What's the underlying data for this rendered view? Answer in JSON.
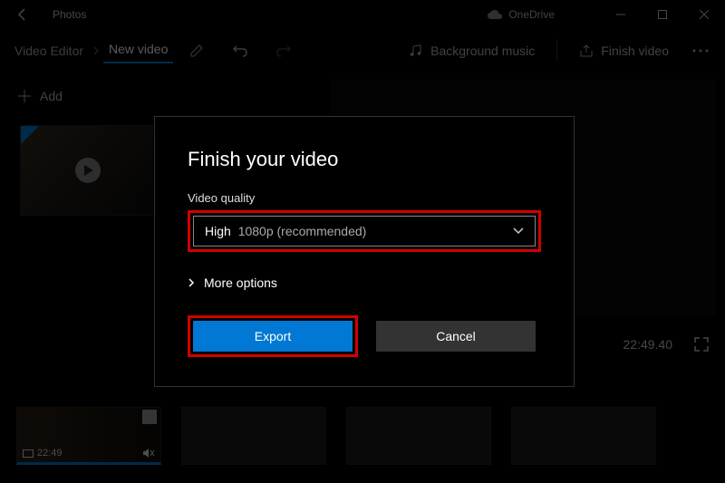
{
  "titlebar": {
    "app_name": "Photos",
    "onedrive_label": "OneDrive"
  },
  "toolbar": {
    "breadcrumb": "Video Editor",
    "project_name": "New video",
    "bg_music": "Background music",
    "finish": "Finish video"
  },
  "library": {
    "add_label": "Add"
  },
  "preview": {
    "timestamp": "22:49.40"
  },
  "storyboard": {
    "clip_duration": "22:49"
  },
  "dialog": {
    "title": "Finish your video",
    "quality_label": "Video quality",
    "quality_value_main": "High",
    "quality_value_sub": "1080p (recommended)",
    "more_options": "More options",
    "export_label": "Export",
    "cancel_label": "Cancel"
  }
}
